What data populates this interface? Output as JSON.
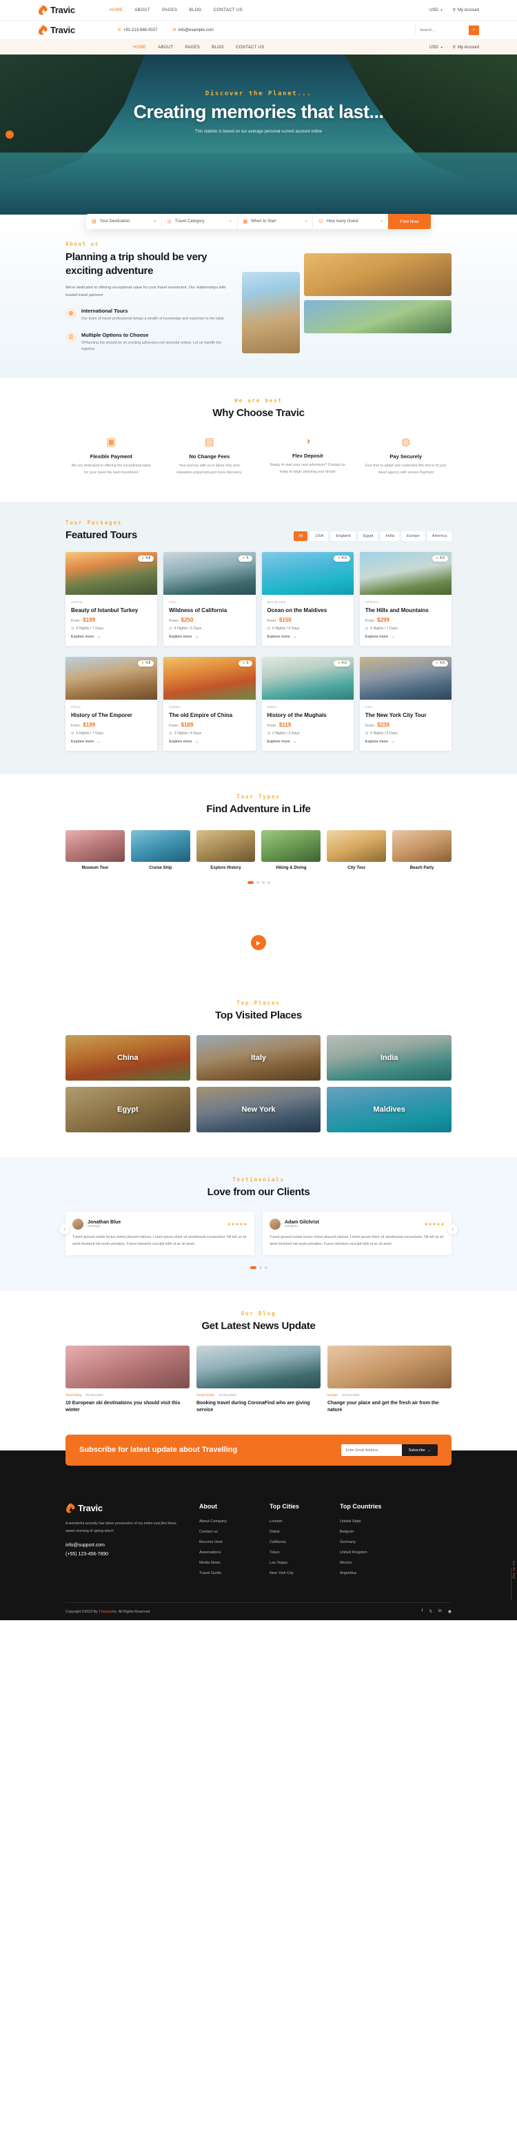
{
  "brand": {
    "name": "Travic"
  },
  "topbar1": {
    "menu": [
      {
        "label": "HOME",
        "active": true
      },
      {
        "label": "ABOUT",
        "active": false
      },
      {
        "label": "PAGES",
        "active": false
      },
      {
        "label": "BLOG",
        "active": false
      },
      {
        "label": "CONTACT US",
        "active": false
      }
    ],
    "currency": "USD",
    "account": "My Account"
  },
  "topbar2": {
    "phone": "+91-213-666-0027",
    "email": "info@example.com",
    "search_placeholder": "Search..."
  },
  "navbar3": {
    "menu": [
      {
        "label": "HOME",
        "active": true
      },
      {
        "label": "ABOUT",
        "active": false
      },
      {
        "label": "PAGES",
        "active": false
      },
      {
        "label": "BLOG",
        "active": false
      },
      {
        "label": "CONTACT US",
        "active": false
      }
    ],
    "currency": "USD",
    "account": "My Account"
  },
  "hero": {
    "eyebrow": "Discover the Planet...",
    "title": "Creating memories that last...",
    "desc": "This statistic is based on our average personal current account online"
  },
  "search_strip": {
    "fields": [
      {
        "label": "Your Destination",
        "icon": "building-icon"
      },
      {
        "label": "Travel Category",
        "icon": "compass-icon"
      },
      {
        "label": "When to Start",
        "icon": "calendar-icon"
      },
      {
        "label": "How many Guest",
        "icon": "people-icon"
      }
    ],
    "button": "Find Now"
  },
  "about": {
    "eyebrow": "About us",
    "title": "Planning a trip should be very exciting adventure",
    "lead": "We're dedicated to offering exceptional value for your travel investment. Our relationships with trusted travel partners",
    "features": [
      {
        "title": "International Tours",
        "text": "Our team of travel professional brings a wealth of knowledge and expertise to the table."
      },
      {
        "title": "Multiple Options to Choose",
        "text": "OPlanning trip should be an exciting adventure,not stressful ordeal. Let us handle the logistics"
      }
    ]
  },
  "why": {
    "eyebrow": "We are best",
    "title": "Why Choose Travic",
    "cards": [
      {
        "icon": "wallet-icon",
        "title": "Flexible Payment",
        "text": "We are dedicated to offering the exceptional value for your travel the best investment"
      },
      {
        "icon": "card-lock-icon",
        "title": "No Change Fees",
        "text": "Your journey with us is about only your relaxation,enjoyment,and more discovery."
      },
      {
        "icon": "piggy-bank-icon",
        "title": "Flex Deposit",
        "text": "Ready to start your next adventure? Contact us today to begin planning your dream"
      },
      {
        "icon": "secure-coins-icon",
        "title": "Pay Securely",
        "text": "Feel free to adapt and customize this text to fit your travel agency with secure Payment"
      }
    ]
  },
  "tours": {
    "eyebrow": "Tour Packages",
    "title": "Featured Tours",
    "filters": [
      {
        "label": "All",
        "active": true
      },
      {
        "label": "USA",
        "active": false
      },
      {
        "label": "England",
        "active": false
      },
      {
        "label": "Egypt",
        "active": false
      },
      {
        "label": "India",
        "active": false
      },
      {
        "label": "Europe",
        "active": false
      },
      {
        "label": "America",
        "active": false
      }
    ],
    "link_label": "Explore more",
    "price_prefix": "From -",
    "items": [
      {
        "category": "JAPAN",
        "name": "Beauty of Istanbul Turkey",
        "price": "$199",
        "duration": "6 Nights / 7 Days",
        "rating": "4.8",
        "img": "im1"
      },
      {
        "category": "USA",
        "name": "Wildness of California",
        "price": "$250",
        "duration": "4 Nights / 5 Days",
        "rating": "5",
        "img": "im2"
      },
      {
        "category": "MALDIVES",
        "name": "Ocean on the Maldives",
        "price": "$150",
        "duration": "5 Nights / 6 Days",
        "rating": "4.0",
        "img": "im3"
      },
      {
        "category": "AFRICA",
        "name": "The Hills and Mountains",
        "price": "$299",
        "duration": "6 Nights / 7 Days",
        "rating": "4.5",
        "img": "im4"
      },
      {
        "category": "ITALY",
        "name": "History of The Emporer",
        "price": "$199",
        "duration": "6 Nights / 7 Days",
        "rating": "4.8",
        "img": "im5"
      },
      {
        "category": "CHINA",
        "name": "The old Empire of China",
        "price": "$189",
        "duration": "3 Nights / 4 Days",
        "rating": "5",
        "img": "im6"
      },
      {
        "category": "INDIA",
        "name": "History of the Mughals",
        "price": "$119",
        "duration": "2 Nights / 3 Days",
        "rating": "4.0",
        "img": "im7"
      },
      {
        "category": "USA",
        "name": "The New York City Tour",
        "price": "$239",
        "duration": "5 Nights / 6 Days",
        "rating": "4.5",
        "img": "im8"
      }
    ]
  },
  "types": {
    "eyebrow": "Tour Types",
    "title": "Find Adventure in Life",
    "items": [
      {
        "label": "Museum Tour",
        "img": "im9"
      },
      {
        "label": "Cruise Ship",
        "img": "im10"
      },
      {
        "label": "Explore History",
        "img": "im11"
      },
      {
        "label": "Hiking & Diving",
        "img": "im12"
      },
      {
        "label": "City Tour",
        "img": "im13"
      },
      {
        "label": "Beach Party",
        "img": "im14"
      }
    ]
  },
  "video": {
    "play": "play-button"
  },
  "places": {
    "eyebrow": "Top Places",
    "title": "Top Visited Places",
    "items": [
      {
        "name": "China",
        "img": "im6"
      },
      {
        "name": "Italy",
        "img": "im5"
      },
      {
        "name": "India",
        "img": "im7"
      },
      {
        "name": "Egypt",
        "img": "im11"
      },
      {
        "name": "New York",
        "img": "im8"
      },
      {
        "name": "Maldives",
        "img": "im3"
      }
    ]
  },
  "testimonials": {
    "eyebrow": "Testimonials",
    "title": "Love from our Clients",
    "items": [
      {
        "name": "Jonathan Blue",
        "role": "Manager",
        "stars": "★★★★★",
        "text": "Tuned ground nulate lectus minso placerit ultrices. Lorem ipsum dolor sit ametionsat consectetur. Nit tell us sit amet tincidunt nib turpis penatius. Fusce interdum suscipit nibh ut ac sit amet."
      },
      {
        "name": "Adam Gilchrist",
        "role": "Designer",
        "stars": "★★★★★",
        "text": "Tuned ground nulate lectus minso placerit ultrices. Lorem ipsum dolor sit ametionsat consectetur. Nit tell us sit amet tincidunt nib turpis penatius. Fusce interdum suscipit nibh ut ac sit amet."
      }
    ]
  },
  "blog": {
    "eyebrow": "Our Blog",
    "title": "Get Latest News Update",
    "items": [
      {
        "tag": "Travel Blog",
        "date": "25 Nov,2023",
        "title": "10 European ski destinations you should visit this winter",
        "img": "im9"
      },
      {
        "tag": "Travel Guide",
        "date": "19 Nov,2023",
        "title": "Booking travel during CoronaFind who are giving service",
        "img": "im2"
      },
      {
        "tag": "Europe",
        "date": "15 Nov,2023",
        "title": "Change your place and get the fresh air from the nature",
        "img": "im14"
      }
    ]
  },
  "subscribe": {
    "title": "Subscribe for latest update about Travelling",
    "placeholder": "Enter Email Address",
    "button": "Subscribe"
  },
  "footer": {
    "about_text": "A wonderful serenity has taken possession of my entire soul,like these sweet morning of spring which",
    "email": "info@support.com",
    "phone": "(+55) 123-456-7890",
    "columns": [
      {
        "title": "About",
        "links": [
          "About Company",
          "Contact us",
          "Become Host",
          "Associations",
          "Media News",
          "Travel Guide"
        ]
      },
      {
        "title": "Top Cities",
        "links": [
          "London",
          "Dubai",
          "California",
          "Tokyo",
          "Las Vegas",
          "New York City"
        ]
      },
      {
        "title": "Top Countries",
        "links": [
          "United State",
          "Belgium",
          "Germany",
          "United Kingdom",
          "Mexico",
          "Argentina"
        ]
      }
    ],
    "copyright_pre": "Copyright ©2023 By ",
    "copyright_link": "17sucai",
    "copyright_post": ",Inc. All Rights Reserved",
    "social": [
      "facebook-icon",
      "twitter-icon",
      "linkedin-icon",
      "dribbble-icon"
    ],
    "go_to_top": "Go To Top"
  },
  "colors": {
    "accent": "#f4711f",
    "gold": "#f4b03c",
    "dark": "#141414"
  }
}
